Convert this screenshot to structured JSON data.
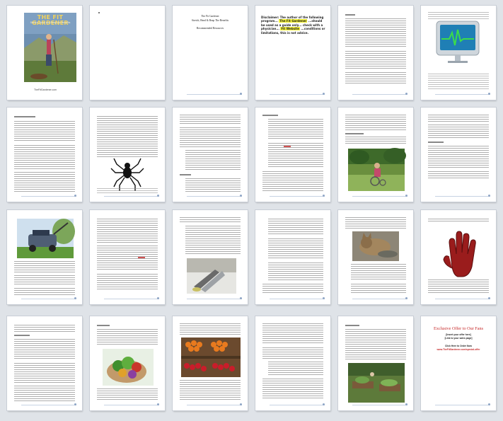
{
  "document": {
    "cover": {
      "title": "THE FIT GARDENER",
      "subtitle": "Stretch, Bend and Reap the Benefits",
      "caption": "TheFitGardener.com"
    },
    "page3": {
      "title": "The Fit Gardener",
      "subtitle": "Stretch, Bend & Reap The Benefits",
      "note": "Recommended Resources"
    },
    "page4": {
      "disclaimer_start": "Disclaimer: The author of the following program... ",
      "highlight_1": "The Fit Gardener",
      "disclaimer_middle": " ...should be used as a guide only... check with a physician... ",
      "highlight_2": "Fit Website",
      "disclaimer_end": " ...conditions or limitations, this is not advice."
    },
    "last_page": {
      "offer_title": "Exclusive Offer to Our Fans",
      "line_1": "[Insert your offer here]",
      "line_2": "[Link to your sales page]",
      "line_3": "Click Here to Order Now",
      "line_4": "www.TheFitGardener.com/special-offer"
    }
  },
  "colors": {
    "workspace_bg": "#dfe3e8",
    "page_bg": "#ffffff",
    "cover_title": "#f3d25b",
    "offer_red": "#c62828",
    "highlight": "#f4f23a"
  },
  "icons": [
    "heartbeat-monitor-icon",
    "spider-icon",
    "glove-hand-icon"
  ]
}
